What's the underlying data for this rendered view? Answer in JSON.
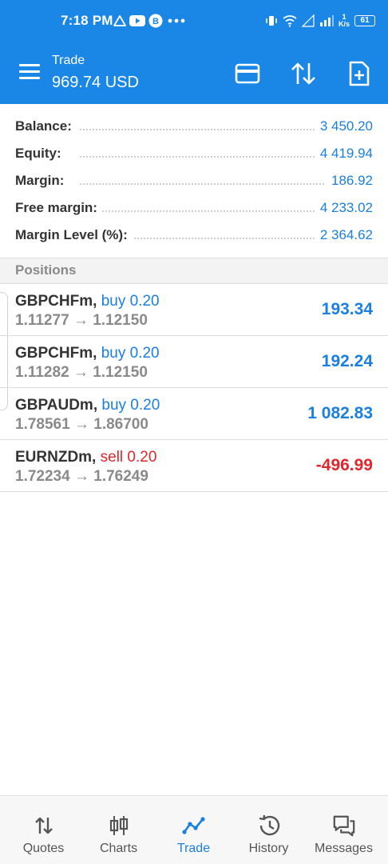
{
  "status_bar": {
    "time": "7:18 PM",
    "battery": "61",
    "net_speed_value": "1",
    "net_speed_unit": "K/s"
  },
  "toolbar": {
    "title": "Trade",
    "balance_display": "969.74 USD",
    "icons": [
      "card-icon",
      "sort-arrows-icon",
      "new-order-icon"
    ]
  },
  "summary": [
    {
      "label": "Balance:",
      "value": "3 450.20"
    },
    {
      "label": "Equity:",
      "value": "4 419.94"
    },
    {
      "label": "Margin:",
      "value": "186.92"
    },
    {
      "label": "Free margin:",
      "value": "4 233.02"
    },
    {
      "label": "Margin Level (%):",
      "value": "2 364.62"
    }
  ],
  "positions_section": {
    "title": "Positions"
  },
  "positions": [
    {
      "symbol": "GBPCHFm,",
      "side": "buy 0.20",
      "open_price": "1.11277",
      "arrow": "→",
      "current_price": "1.12150",
      "profit": "193.34",
      "direction": "buy"
    },
    {
      "symbol": "GBPCHFm,",
      "side": "buy 0.20",
      "open_price": "1.11282",
      "arrow": "→",
      "current_price": "1.12150",
      "profit": "192.24",
      "direction": "buy"
    },
    {
      "symbol": "GBPAUDm,",
      "side": "buy 0.20",
      "open_price": "1.78561",
      "arrow": "→",
      "current_price": "1.86700",
      "profit": "1 082.83",
      "direction": "buy"
    },
    {
      "symbol": "EURNZDm,",
      "side": "sell 0.20",
      "open_price": "1.72234",
      "arrow": "→",
      "current_price": "1.76249",
      "profit": "-496.99",
      "direction": "sell"
    }
  ],
  "bottom_nav": [
    {
      "label": "Quotes",
      "icon": "quotes-arrows-icon",
      "active": false
    },
    {
      "label": "Charts",
      "icon": "candlestick-icon",
      "active": false
    },
    {
      "label": "Trade",
      "icon": "trade-line-icon",
      "active": true
    },
    {
      "label": "History",
      "icon": "history-clock-icon",
      "active": false
    },
    {
      "label": "Messages",
      "icon": "messages-icon",
      "active": false
    }
  ],
  "colors": {
    "primary": "#1a86e6",
    "positive": "#1a7fe0",
    "negative": "#e0262a"
  }
}
